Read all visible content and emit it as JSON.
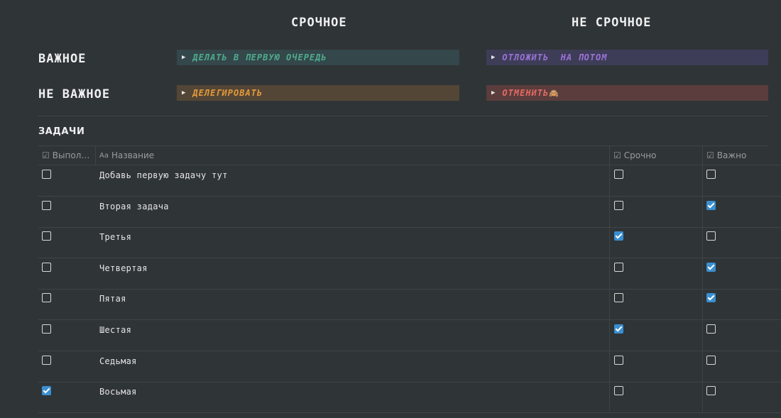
{
  "matrix": {
    "col_headers": [
      "СРОЧНОЕ",
      "НЕ СРОЧНОЕ"
    ],
    "row_headers": [
      "ВАЖНОЕ",
      "НЕ ВАЖНОЕ"
    ],
    "quadrants": {
      "do_first": "ДЕЛАТЬ В ПЕРВУЮ ОЧЕРЕДЬ",
      "postpone": "ОТЛОЖИТЬ  НА ПОТОМ",
      "delegate": "ДЕЛЕГИРОВАТЬ",
      "cancel": "ОТМЕНИТЬ",
      "cancel_emoji": "🙈"
    },
    "colors": {
      "green": "#4faa8c",
      "purple": "#9a72d6",
      "orange": "#e39a3c",
      "red": "#e46a64"
    },
    "toggle_icon": "triangle-right-icon"
  },
  "tasks": {
    "title": "ЗАДАЧИ",
    "columns": {
      "done": "Выпол…",
      "name": "Название",
      "urgent": "Срочно",
      "important": "Важно"
    },
    "column_icons": {
      "done": "checkbox-property-icon",
      "name": "text-property-icon",
      "urgent": "checkbox-property-icon",
      "important": "checkbox-property-icon"
    },
    "rows": [
      {
        "name": "Добавь первую задачу тут",
        "done": false,
        "urgent": false,
        "important": false
      },
      {
        "name": "Вторая задача",
        "done": false,
        "urgent": false,
        "important": true
      },
      {
        "name": "Третья",
        "done": false,
        "urgent": true,
        "important": false
      },
      {
        "name": "Четвертая",
        "done": false,
        "urgent": false,
        "important": true
      },
      {
        "name": "Пятая",
        "done": false,
        "urgent": false,
        "important": true
      },
      {
        "name": "Шестая",
        "done": false,
        "urgent": true,
        "important": false
      },
      {
        "name": "Седьмая",
        "done": false,
        "urgent": false,
        "important": false
      },
      {
        "name": "Восьмая",
        "done": true,
        "urgent": false,
        "important": false
      }
    ],
    "accent_checked": "#3a8fd0"
  }
}
